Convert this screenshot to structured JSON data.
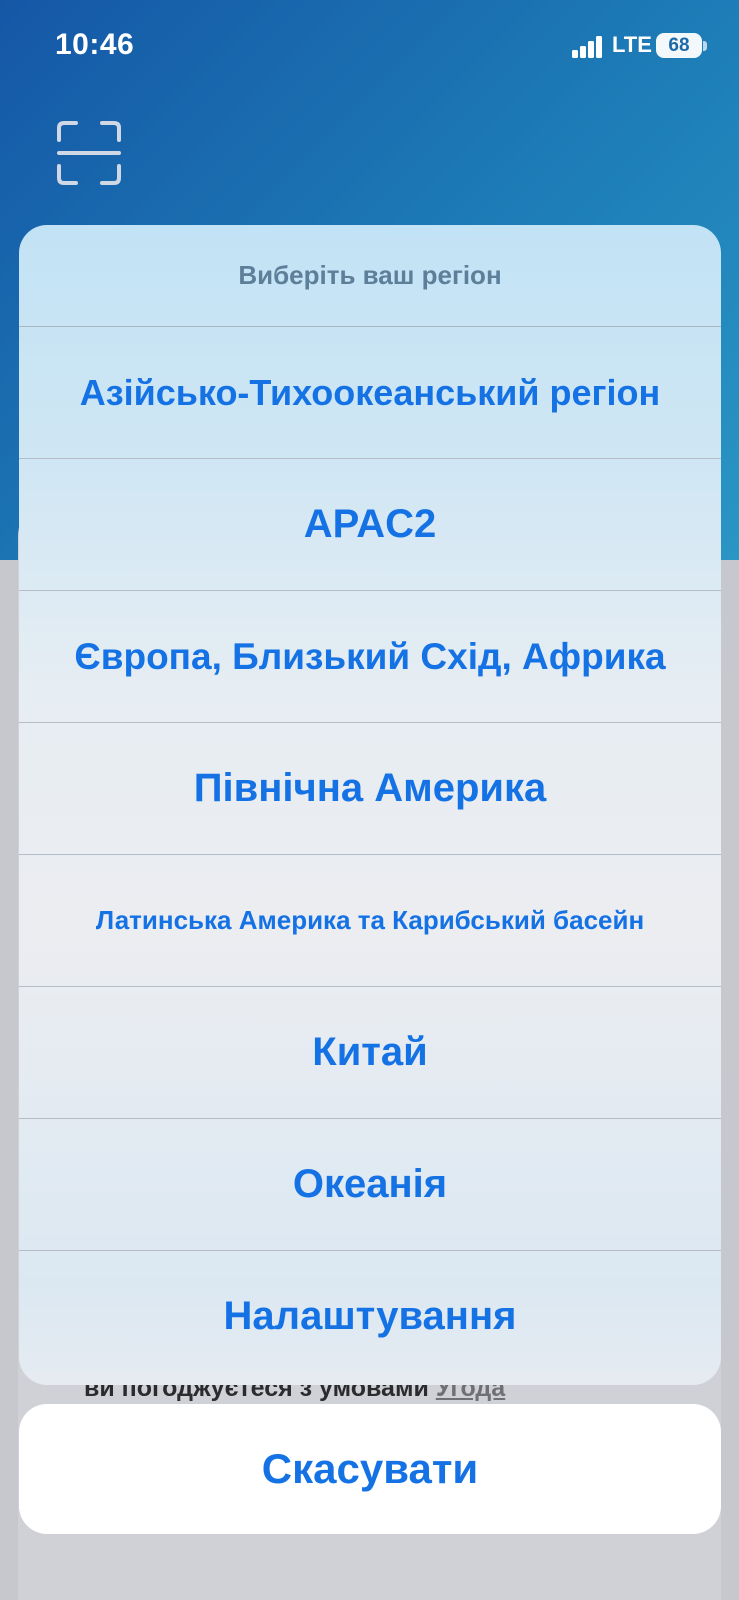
{
  "status_bar": {
    "time": "10:46",
    "network": "LTE",
    "battery": "68"
  },
  "header": {
    "scan_icon": "scan-frame-icon"
  },
  "action_sheet": {
    "title": "Виберіть ваш регіон",
    "options": [
      {
        "label": "Азійсько-Тихоокеанський регіон"
      },
      {
        "label": "APAC2"
      },
      {
        "label": "Європа, Близький Схід, Африка"
      },
      {
        "label": "Північна Америка"
      },
      {
        "label": "Латинська Америка та Карибський басейн"
      },
      {
        "label": "Китай"
      },
      {
        "label": "Океанія"
      },
      {
        "label": "Налаштування"
      }
    ],
    "cancel_label": "Скасувати"
  },
  "background": {
    "legal_text": "ви погоджуєтеся з умовами",
    "legal_link": "Угода"
  },
  "colors": {
    "accent": "#1572e5",
    "header_gradient_start": "#1557a6",
    "header_gradient_end": "#2a96c4"
  }
}
